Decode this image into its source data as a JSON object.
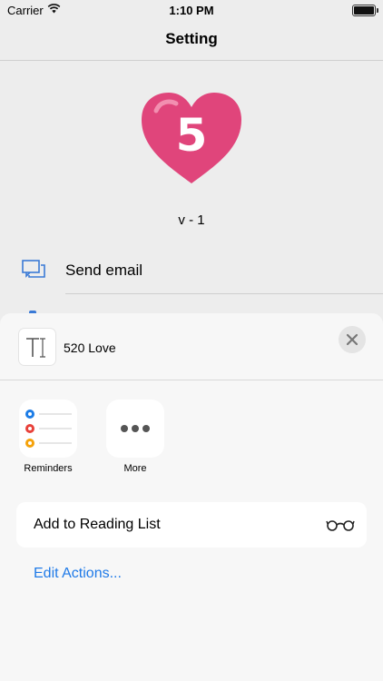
{
  "status": {
    "carrier": "Carrier",
    "time": "1:10 PM"
  },
  "nav": {
    "title": "Setting"
  },
  "app": {
    "logo_digit": "5",
    "version": "v - 1",
    "settings_items": [
      {
        "label": "Send email",
        "icon": "chat-icon"
      }
    ]
  },
  "share_sheet": {
    "title": "520 Love",
    "apps": [
      {
        "label": "Reminders",
        "icon": "reminders-icon"
      },
      {
        "label": "More",
        "icon": "more-icon"
      }
    ],
    "actions": [
      {
        "label": "Add to Reading List",
        "icon": "glasses-icon"
      }
    ],
    "edit_actions": "Edit Actions..."
  },
  "colors": {
    "heart": "#e0457b",
    "link": "#1f7ae8",
    "reminder_blue": "#1c7ce6",
    "reminder_red": "#e8413a",
    "reminder_orange": "#f5a20a"
  }
}
